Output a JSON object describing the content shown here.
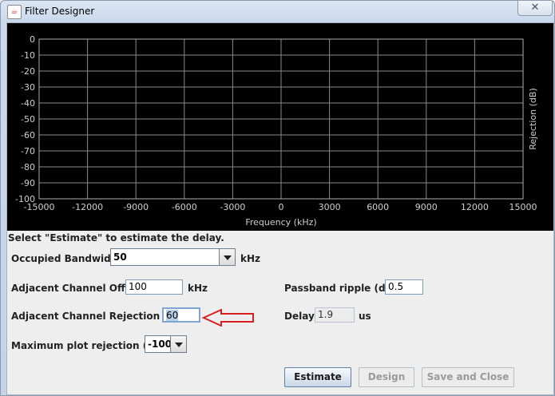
{
  "window": {
    "title": "Filter Designer",
    "close_glyph": "✕"
  },
  "plot": {
    "background": "#000000",
    "y_ticks": [
      "0",
      "-10",
      "-20",
      "-30",
      "-40",
      "-50",
      "-60",
      "-70",
      "-80",
      "-90",
      "-100"
    ],
    "x_ticks": [
      "-15000",
      "-12000",
      "-9000",
      "-6000",
      "-3000",
      "0",
      "3000",
      "6000",
      "9000",
      "12000",
      "15000"
    ],
    "xlabel": "Frequency (kHz)",
    "ylabel": "Rejection (dB)",
    "xlim": [
      -15000,
      15000
    ],
    "ylim": [
      -100,
      0
    ],
    "grid": true
  },
  "status_text": "Select \"Estimate\" to estimate the delay.",
  "form": {
    "occupied_bandwidth": {
      "label": "Occupied Bandwidth:",
      "value": "50",
      "unit": "kHz"
    },
    "adjacent_offset": {
      "label": "Adjacent Channel Offset:",
      "value": "100",
      "unit": "kHz"
    },
    "passband_ripple": {
      "label": "Passband ripple (dB):",
      "value": "0.5"
    },
    "adjacent_rejection": {
      "label": "Adjacent Channel Rejection (dB):",
      "value": "60"
    },
    "delay": {
      "label": "Delay:",
      "value": "1.9",
      "unit": "us"
    },
    "max_plot_rejection": {
      "label": "Maximum plot rejection (dB):",
      "value": "-100"
    }
  },
  "buttons": {
    "estimate": "Estimate",
    "design": "Design",
    "save_close": "Save and Close"
  },
  "annotation": {
    "color": "#d42020",
    "icon": "red-arrow-icon"
  }
}
